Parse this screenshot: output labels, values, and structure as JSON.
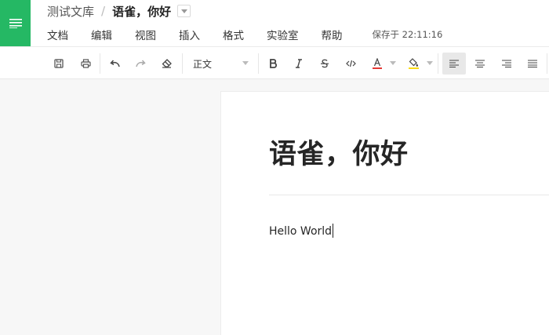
{
  "header": {
    "breadcrumb": {
      "library": "测试文库",
      "separator": "/",
      "document": "语雀，你好"
    },
    "menu": [
      "文档",
      "编辑",
      "视图",
      "插入",
      "格式",
      "实验室",
      "帮助"
    ],
    "save_status": "保存于 22:11:16"
  },
  "toolbar": {
    "paragraph_style": "正文",
    "icons": [
      "save-icon",
      "print-icon",
      "undo-icon",
      "redo-icon",
      "clear-format-icon",
      "bold-icon",
      "italic-icon",
      "strikethrough-icon",
      "code-icon",
      "font-color-icon",
      "highlight-icon",
      "align-left-icon",
      "align-center-icon",
      "align-right-icon",
      "justify-icon"
    ],
    "colors": {
      "font_color": "#e53935",
      "highlight": "#fadb14",
      "accent": "#25b864"
    }
  },
  "document": {
    "title": "语雀，你好",
    "body": "Hello World"
  }
}
